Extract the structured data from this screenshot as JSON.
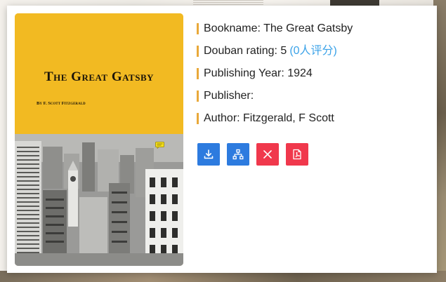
{
  "book": {
    "cover": {
      "title": "The Great Gatsby",
      "author": "By F. Scott Fitzgerald",
      "accent_color": "#f2ba22"
    },
    "bookname": "Bookname: The Great Gatsby",
    "douban_rating_text": "Douban rating: 5",
    "douban_rating_count": "(0人评分)",
    "publishing_year": "Publishing Year: 1924",
    "publisher": "Publisher:",
    "author": "Author: Fitzgerald, F Scott"
  },
  "actions": [
    {
      "name": "download",
      "icon": "download-icon",
      "color": "#2d7bdf"
    },
    {
      "name": "structure",
      "icon": "sitemap-icon",
      "color": "#2d7bdf"
    },
    {
      "name": "close",
      "icon": "close-icon",
      "color": "#f0384c"
    },
    {
      "name": "pdf",
      "icon": "pdf-file-icon",
      "color": "#f0384c"
    }
  ],
  "colors": {
    "row_marker": "#e9a93a",
    "rating_link": "#3aa2e8"
  }
}
